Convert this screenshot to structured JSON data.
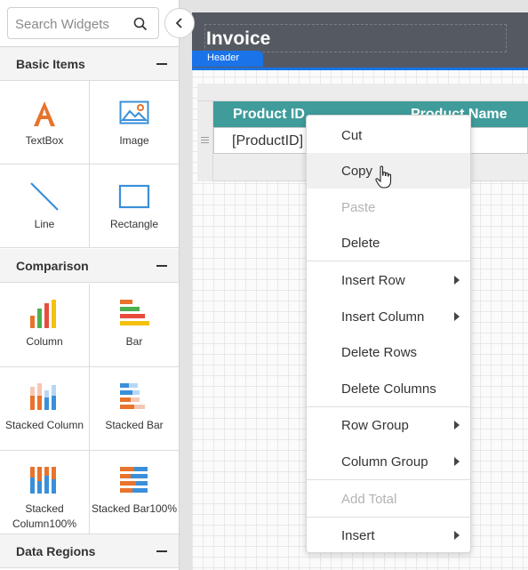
{
  "search": {
    "placeholder": "Search Widgets"
  },
  "sidebar": {
    "sections": [
      {
        "title": "Basic Items",
        "items": [
          {
            "label": "TextBox",
            "icon": "textbox-icon"
          },
          {
            "label": "Image",
            "icon": "image-icon"
          },
          {
            "label": "Line",
            "icon": "line-icon"
          },
          {
            "label": "Rectangle",
            "icon": "rectangle-icon"
          }
        ]
      },
      {
        "title": "Comparison",
        "items": [
          {
            "label": "Column",
            "icon": "column-chart-icon"
          },
          {
            "label": "Bar",
            "icon": "bar-chart-icon"
          },
          {
            "label": "Stacked Column",
            "icon": "stacked-column-chart-icon"
          },
          {
            "label": "Stacked Bar",
            "icon": "stacked-bar-chart-icon"
          },
          {
            "label": "Stacked Column100%",
            "icon": "stacked-column-100-icon"
          },
          {
            "label": "Stacked Bar100%",
            "icon": "stacked-bar-100-icon"
          }
        ]
      },
      {
        "title": "Data Regions",
        "items": []
      }
    ]
  },
  "report": {
    "title": "Invoice",
    "band_label": "Header",
    "table": {
      "columns": [
        "Product ID",
        "Product Name"
      ],
      "row": [
        "[ProductID]",
        ""
      ]
    }
  },
  "context_menu": {
    "items": [
      {
        "label": "Cut",
        "disabled": false,
        "submenu": false
      },
      {
        "label": "Copy",
        "disabled": false,
        "submenu": false,
        "hovered": true
      },
      {
        "label": "Paste",
        "disabled": true,
        "submenu": false
      },
      {
        "label": "Delete",
        "disabled": false,
        "submenu": false
      },
      {
        "label": "Insert Row",
        "disabled": false,
        "submenu": true
      },
      {
        "label": "Insert Column",
        "disabled": false,
        "submenu": true
      },
      {
        "label": "Delete Rows",
        "disabled": false,
        "submenu": false
      },
      {
        "label": "Delete Columns",
        "disabled": false,
        "submenu": false
      },
      {
        "label": "Row Group",
        "disabled": false,
        "submenu": true
      },
      {
        "label": "Column Group",
        "disabled": false,
        "submenu": true
      },
      {
        "label": "Add Total",
        "disabled": true,
        "submenu": false
      },
      {
        "label": "Insert",
        "disabled": false,
        "submenu": true
      }
    ]
  },
  "colors": {
    "accent": "#1a73e8",
    "table_header": "#3f9c9b",
    "header_band": "#555a62",
    "textbox_icon": "#e8732c",
    "image_icon": "#3a8fd9"
  }
}
